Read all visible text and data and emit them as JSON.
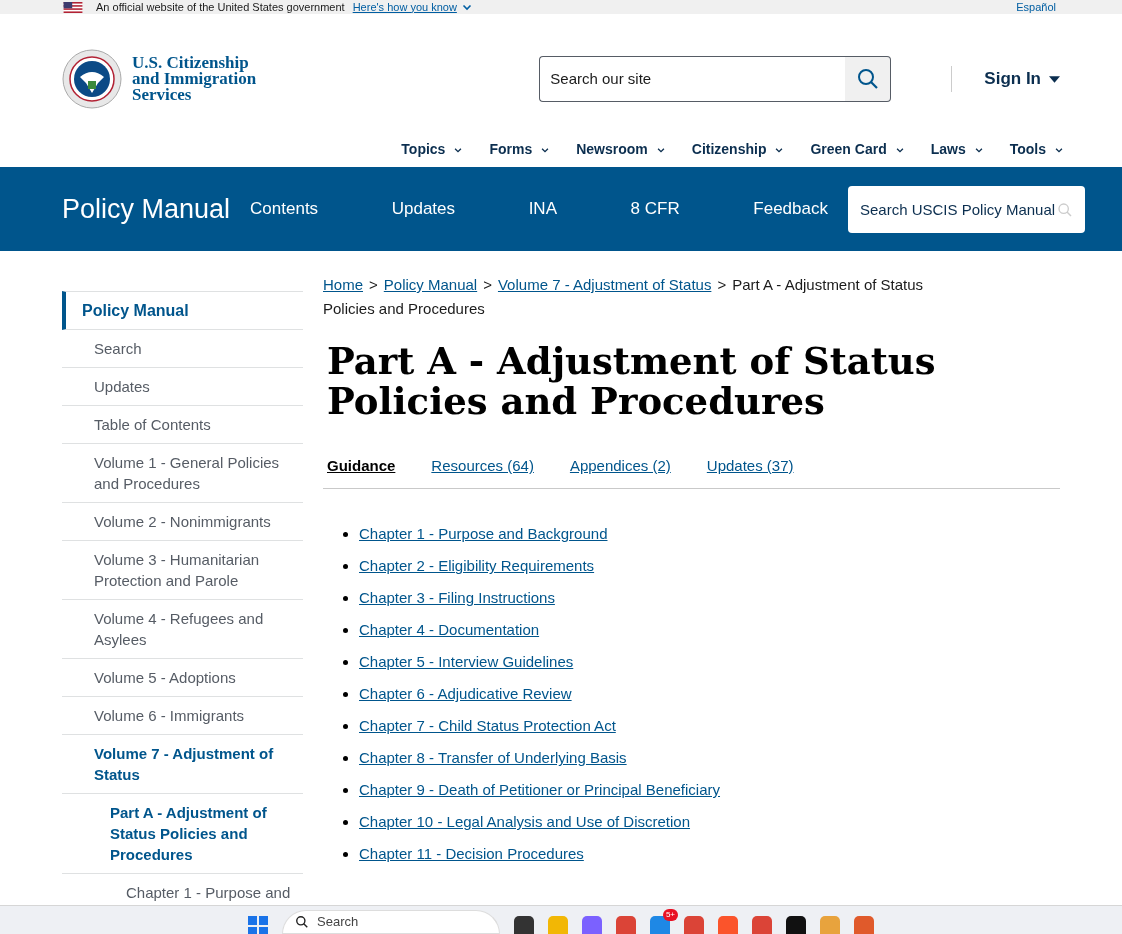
{
  "banner": {
    "text": "An official website of the United States government",
    "link": "Here's how you know",
    "language": "Español"
  },
  "header": {
    "logo_lines": [
      "U.S. Citizenship",
      "and Immigration",
      "Services"
    ],
    "search_placeholder": "Search our site",
    "sign_in": "Sign In",
    "nav": [
      "Topics",
      "Forms",
      "Newsroom",
      "Citizenship",
      "Green Card",
      "Laws",
      "Tools"
    ]
  },
  "policy_bar": {
    "title": "Policy Manual",
    "links": [
      "Contents",
      "Updates",
      "INA",
      "8 CFR",
      "Feedback"
    ],
    "search_placeholder": "Search USCIS Policy Manual"
  },
  "sidebar": {
    "items": [
      {
        "label": "Policy Manual",
        "selected": true
      },
      {
        "label": "Search",
        "selected": false
      },
      {
        "label": "Updates",
        "selected": false
      },
      {
        "label": "Table of Contents",
        "selected": false
      },
      {
        "label": "Volume 1 - General Policies and Procedures",
        "selected": false
      },
      {
        "label": "Volume 2 - Nonimmigrants",
        "selected": false
      },
      {
        "label": "Volume 3 - Humanitarian Protection and Parole",
        "selected": false
      },
      {
        "label": "Volume 4 - Refugees and Asylees",
        "selected": false
      },
      {
        "label": "Volume 5 - Adoptions",
        "selected": false
      },
      {
        "label": "Volume 6 - Immigrants",
        "selected": false
      },
      {
        "label": "Volume 7 - Adjustment of Status",
        "selected": true,
        "children": [
          {
            "label": "Part A - Adjustment of Status Policies and Procedures",
            "selected": true,
            "children": [
              {
                "label": "Chapter 1 - Purpose and",
                "selected": false
              }
            ]
          }
        ]
      }
    ]
  },
  "breadcrumbs": {
    "separator": ">",
    "links": [
      "Home",
      "Policy Manual",
      "Volume 7 - Adjustment of Status"
    ],
    "current": "Part A - Adjustment of Status Policies and Procedures"
  },
  "heading": "Part A - Adjustment of Status Policies and Procedures",
  "tabs": [
    {
      "label": "Guidance",
      "selected": true
    },
    {
      "label": "Resources (64)",
      "selected": false
    },
    {
      "label": "Appendices (2)",
      "selected": false
    },
    {
      "label": "Updates (37)",
      "selected": false
    }
  ],
  "chapters": [
    "Chapter 1 - Purpose and Background",
    "Chapter 2 - Eligibility Requirements",
    "Chapter 3 - Filing Instructions",
    "Chapter 4 - Documentation",
    "Chapter 5 - Interview Guidelines",
    "Chapter 6 - Adjudicative Review",
    "Chapter 7 - Child Status Protection Act",
    "Chapter 8 - Transfer of Underlying Basis",
    "Chapter 9 - Death of Petitioner or Principal Beneficiary",
    "Chapter 10 - Legal Analysis and Use of Discretion",
    "Chapter 11 - Decision Procedures"
  ],
  "taskbar": {
    "search_placeholder": "Search",
    "notification_badge": "5+"
  }
}
